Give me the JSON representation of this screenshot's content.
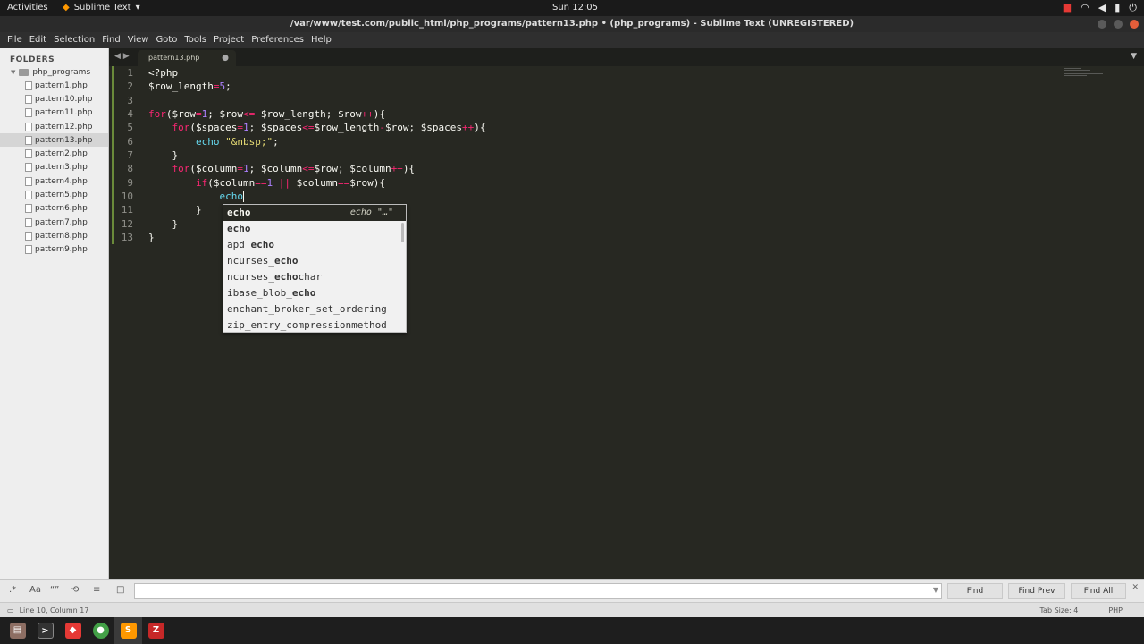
{
  "system": {
    "activities": "Activities",
    "app_name": "Sublime Text",
    "app_dropdown": "▾",
    "clock": "Sun 12:05",
    "tray_icons": [
      "record-icon",
      "wifi-icon",
      "volume-icon",
      "battery-icon",
      "power-icon"
    ]
  },
  "window": {
    "title": "/var/www/test.com/public_html/php_programs/pattern13.php • (php_programs) - Sublime Text (UNREGISTERED)"
  },
  "menu": [
    "File",
    "Edit",
    "Selection",
    "Find",
    "View",
    "Goto",
    "Tools",
    "Project",
    "Preferences",
    "Help"
  ],
  "sidebar": {
    "title": "FOLDERS",
    "folder": "php_programs",
    "files": [
      "pattern1.php",
      "pattern10.php",
      "pattern11.php",
      "pattern12.php",
      "pattern13.php",
      "pattern2.php",
      "pattern3.php",
      "pattern4.php",
      "pattern5.php",
      "pattern6.php",
      "pattern7.php",
      "pattern8.php",
      "pattern9.php"
    ],
    "active_file": "pattern13.php"
  },
  "tab": {
    "label": "pattern13.php",
    "dirty_marker": "●"
  },
  "editor": {
    "line_numbers": [
      "1",
      "2",
      "3",
      "4",
      "5",
      "6",
      "7",
      "8",
      "9",
      "10",
      "11",
      "12",
      "13"
    ],
    "cursor": {
      "line": 10,
      "column": 17
    }
  },
  "autocomplete": {
    "hint": "echo \"…\"",
    "items": [
      [
        "echo"
      ],
      [
        "echo"
      ],
      [
        "apd_",
        "echo"
      ],
      [
        "ncurses_",
        "echo"
      ],
      [
        "ncurses_",
        "echo",
        "char"
      ],
      [
        "ibase_blob_",
        "echo"
      ],
      [
        "enchant_broker_set_ordering"
      ],
      [
        "zip_entry_compressionmethod"
      ]
    ],
    "selected_index": 0
  },
  "findbar": {
    "options": [
      "regex-icon",
      "case-sensitive-icon",
      "whole-word-icon",
      "wrap-icon",
      "in-selection-icon",
      "highlight-icon"
    ],
    "case_label": "Aa",
    "find_label": "Find",
    "find_prev_label": "Find Prev",
    "find_all_label": "Find All",
    "input_value": ""
  },
  "statusbar": {
    "position": "Line 10, Column 17",
    "tab_size": "Tab Size: 4",
    "syntax": "PHP"
  },
  "taskbar": [
    "files-icon",
    "terminal-icon",
    "anydesk-icon",
    "chrome-icon",
    "sublime-icon",
    "filezilla-icon"
  ],
  "colors": {
    "editor_bg": "#272822",
    "keyword": "#f92672",
    "number": "#ae81ff",
    "string": "#e6db74",
    "function": "#66d9ef"
  }
}
